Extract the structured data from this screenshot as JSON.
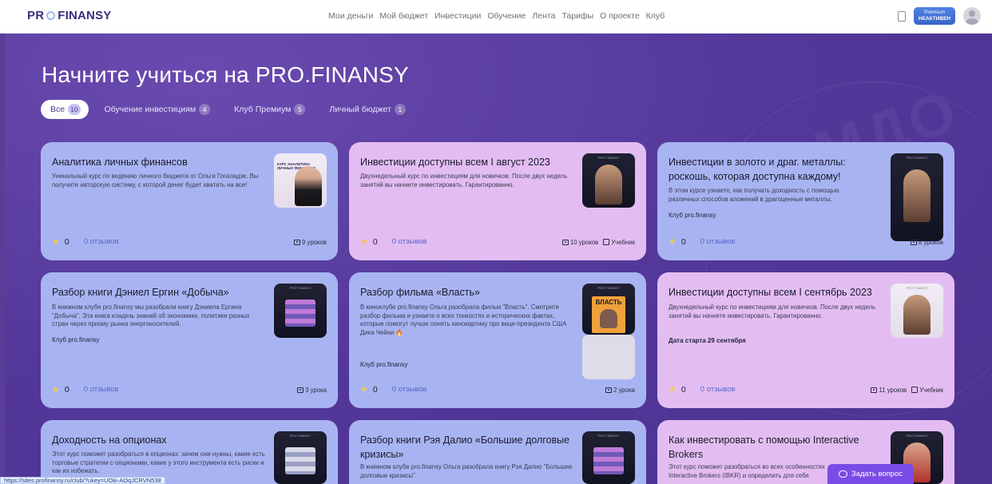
{
  "header": {
    "logo_left": "PR",
    "logo_right": "FINANSY",
    "nav": [
      "Мои деньги",
      "Мой бюджет",
      "Инвестиции",
      "Обучение",
      "Лента",
      "Тарифы",
      "О проекте",
      "Клуб"
    ],
    "premium_top": "Premium",
    "premium_bottom": "НЕАКТИВЕН"
  },
  "page": {
    "title": "Начните учиться на PRO.FINANSY",
    "filters": [
      {
        "label": "Все",
        "count": "10"
      },
      {
        "label": "Обучение инвестициям",
        "count": "4"
      },
      {
        "label": "Клуб Премиум",
        "count": "5"
      },
      {
        "label": "Личный бюджет",
        "count": "1"
      }
    ]
  },
  "cards": [
    {
      "title": "Аналитика личных финансов",
      "desc": "Уникальный курс по ведению личного бюджета от Ольги Гогаладзе. Вы получите авторскую систему, с которой денег будет хватать на все!",
      "rating": "0",
      "reviews": "0 отзывов",
      "lessons": "9 уроков",
      "thumb_text": "КУРС АНАЛИТИКА ЛИЧНЫХ ФИНАНСОВ"
    },
    {
      "title": "Инвестиции доступны всем I август 2023",
      "desc": "Двухнедельный курс по инвестициям для новичков. После двух недель занятий вы начнете инвестировать. Гарантированно.",
      "rating": "0",
      "reviews": "0 отзывов",
      "lessons": "10 уроков",
      "extra": "Учебник"
    },
    {
      "title": "Инвестиции в золото и драг. металлы: роскошь, которая доступна каждому!",
      "desc": "В этом курсе узнаете, как получать доходность с помощью различных способов вложений в драгоценные металлы.",
      "club": "Клуб pro.finansy",
      "rating": "0",
      "reviews": "0 отзывов",
      "lessons": "8 уроков"
    },
    {
      "title": "Разбор книги Дэниел Ергин «Добыча»",
      "desc": "В книжном клубе pro.finansy мы разобрали книгу Дэниела Ергина \"Добыча\". Эта книга кладезь знаний об экономике, политике разных стран через призму рынка энергоносителей.",
      "club": "Клуб pro.finansy",
      "rating": "0",
      "reviews": "0 отзывов",
      "lessons": "3 урока"
    },
    {
      "title": "Разбор фильма «Власть»",
      "desc": "В киноклубе pro.finansy Ольга разобрала фильм \"Власть\". Смотрите разбор фильма и узнаете о всех тонкостях и исторических фактах, которые помогут лучше понять кинокартину про вице-президента США Дика Чейни 🔥",
      "club": "Клуб pro.finansy",
      "rating": "0",
      "reviews": "0 отзывов",
      "lessons": "2 урока",
      "poster": "ВЛАСТЬ"
    },
    {
      "title": "Инвестиции доступны всем I сентябрь 2023",
      "desc": "Двухнедельный курс по инвестициям для новичков. После двух недель занятий вы начнете инвестировать. Гарантированно.",
      "club": "Дата старта 29 сентября",
      "rating": "0",
      "reviews": "0 отзывов",
      "lessons": "11 уроков",
      "extra": "Учебник"
    },
    {
      "title": "Доходность на опционах",
      "desc": "Этот курс поможет разобраться в опционах: зачем они нужны, какие есть торговые стратегии с опционами, какие у этого инструмента есть риски и как их избежать."
    },
    {
      "title": "Разбор книги Рэя Далио «Большие долговые кризисы»",
      "desc": "В книжном клубе pro.finansy Ольга разобрала книгу Рэя Далио \"Большие долговые кризисы\"."
    },
    {
      "title": "Как инвестировать с помощью Interactive Brokers",
      "desc": "Этот курс поможет разобраться во всех особенностях Interactive Brokers (IBKR) и определить для себя"
    }
  ],
  "status_url": "https://sites.profinansy.ru/club/?ukey=UOki-AOqJCRVN538",
  "ask_button": "Задать вопрос"
}
